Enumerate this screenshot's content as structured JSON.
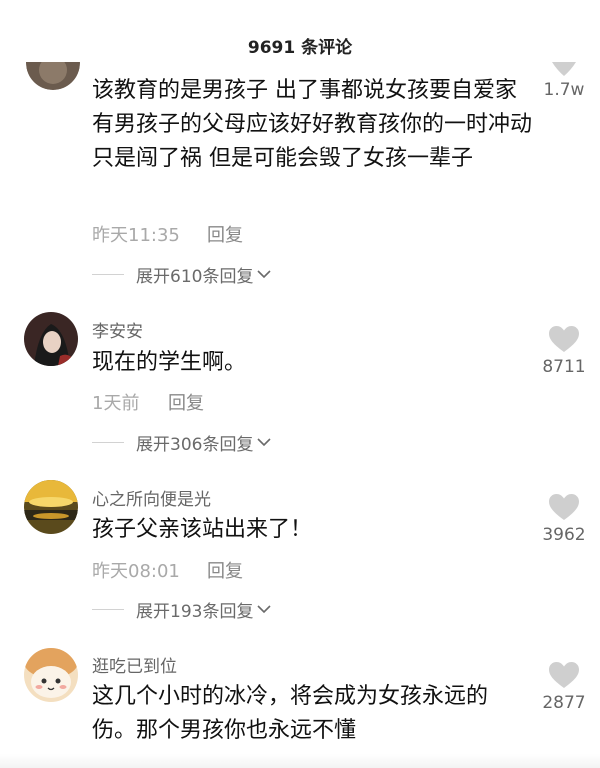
{
  "header": {
    "title": "9691 条评论"
  },
  "comments": [
    {
      "username": "",
      "text": "该教育的是男孩子 出了事都说女孩要自爱家有男孩子的父母应该好好教育孩你的一时冲动只是闯了祸 但是可能会毁了女孩一辈子",
      "time": "昨天11:35",
      "reply_label": "回复",
      "expand_label": "展开610条回复",
      "likes": "1.7w"
    },
    {
      "username": "李安安",
      "text": "现在的学生啊。",
      "time": "1天前",
      "reply_label": "回复",
      "expand_label": "展开306条回复",
      "likes": "8711"
    },
    {
      "username": "心之所向便是光",
      "text": "孩子父亲该站出来了！",
      "time": "昨天08:01",
      "reply_label": "回复",
      "expand_label": "展开193条回复",
      "likes": "3962"
    },
    {
      "username": "逛吃已到位",
      "text": "这几个小时的冰冷，将会成为女孩永远的伤。那个男孩你也永远不懂",
      "time": "",
      "reply_label": "",
      "expand_label": "",
      "likes": "2877"
    }
  ],
  "icons": {
    "like": "heart-icon",
    "expand": "chevron-down-icon"
  },
  "colors": {
    "muted_text": "#a9a9a9",
    "heart": "#cfcfcf"
  }
}
